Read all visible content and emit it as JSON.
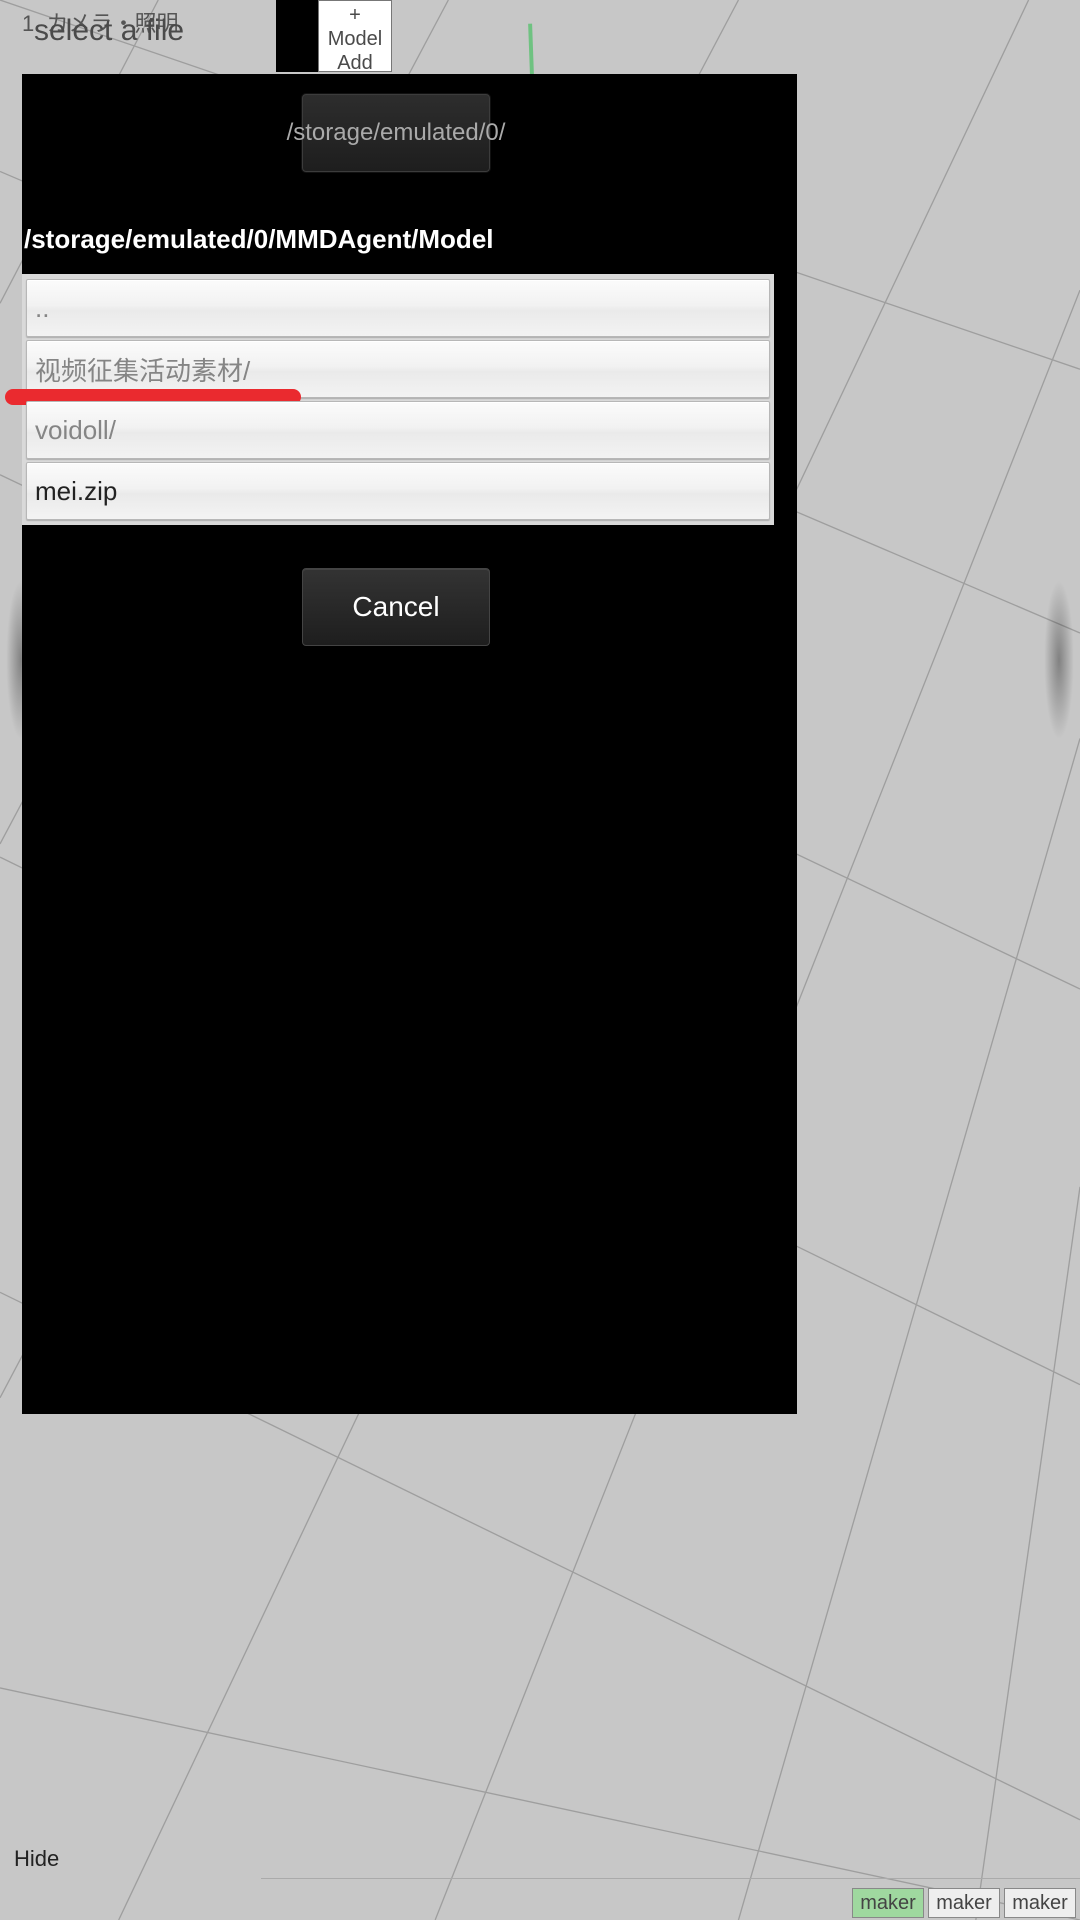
{
  "background": {
    "top_label": "1. カメラ・照明",
    "model_add_plus": "+",
    "model_add_label": "Model Add",
    "hide_label": "Hide",
    "maker_buttons": [
      "maker",
      "maker",
      "maker"
    ]
  },
  "title": "select a file",
  "modal": {
    "storage_button_label": "/storage/emulated/0/",
    "current_path": "/storage/emulated/0/MMDAgent/Model",
    "items": [
      {
        "label": "..",
        "is_file": false,
        "highlighted": false
      },
      {
        "label": "视频征集活动素材/",
        "is_file": false,
        "highlighted": true
      },
      {
        "label": "voidoll/",
        "is_file": false,
        "highlighted": false
      },
      {
        "label": "mei.zip",
        "is_file": true,
        "highlighted": false
      }
    ],
    "cancel_label": "Cancel"
  }
}
